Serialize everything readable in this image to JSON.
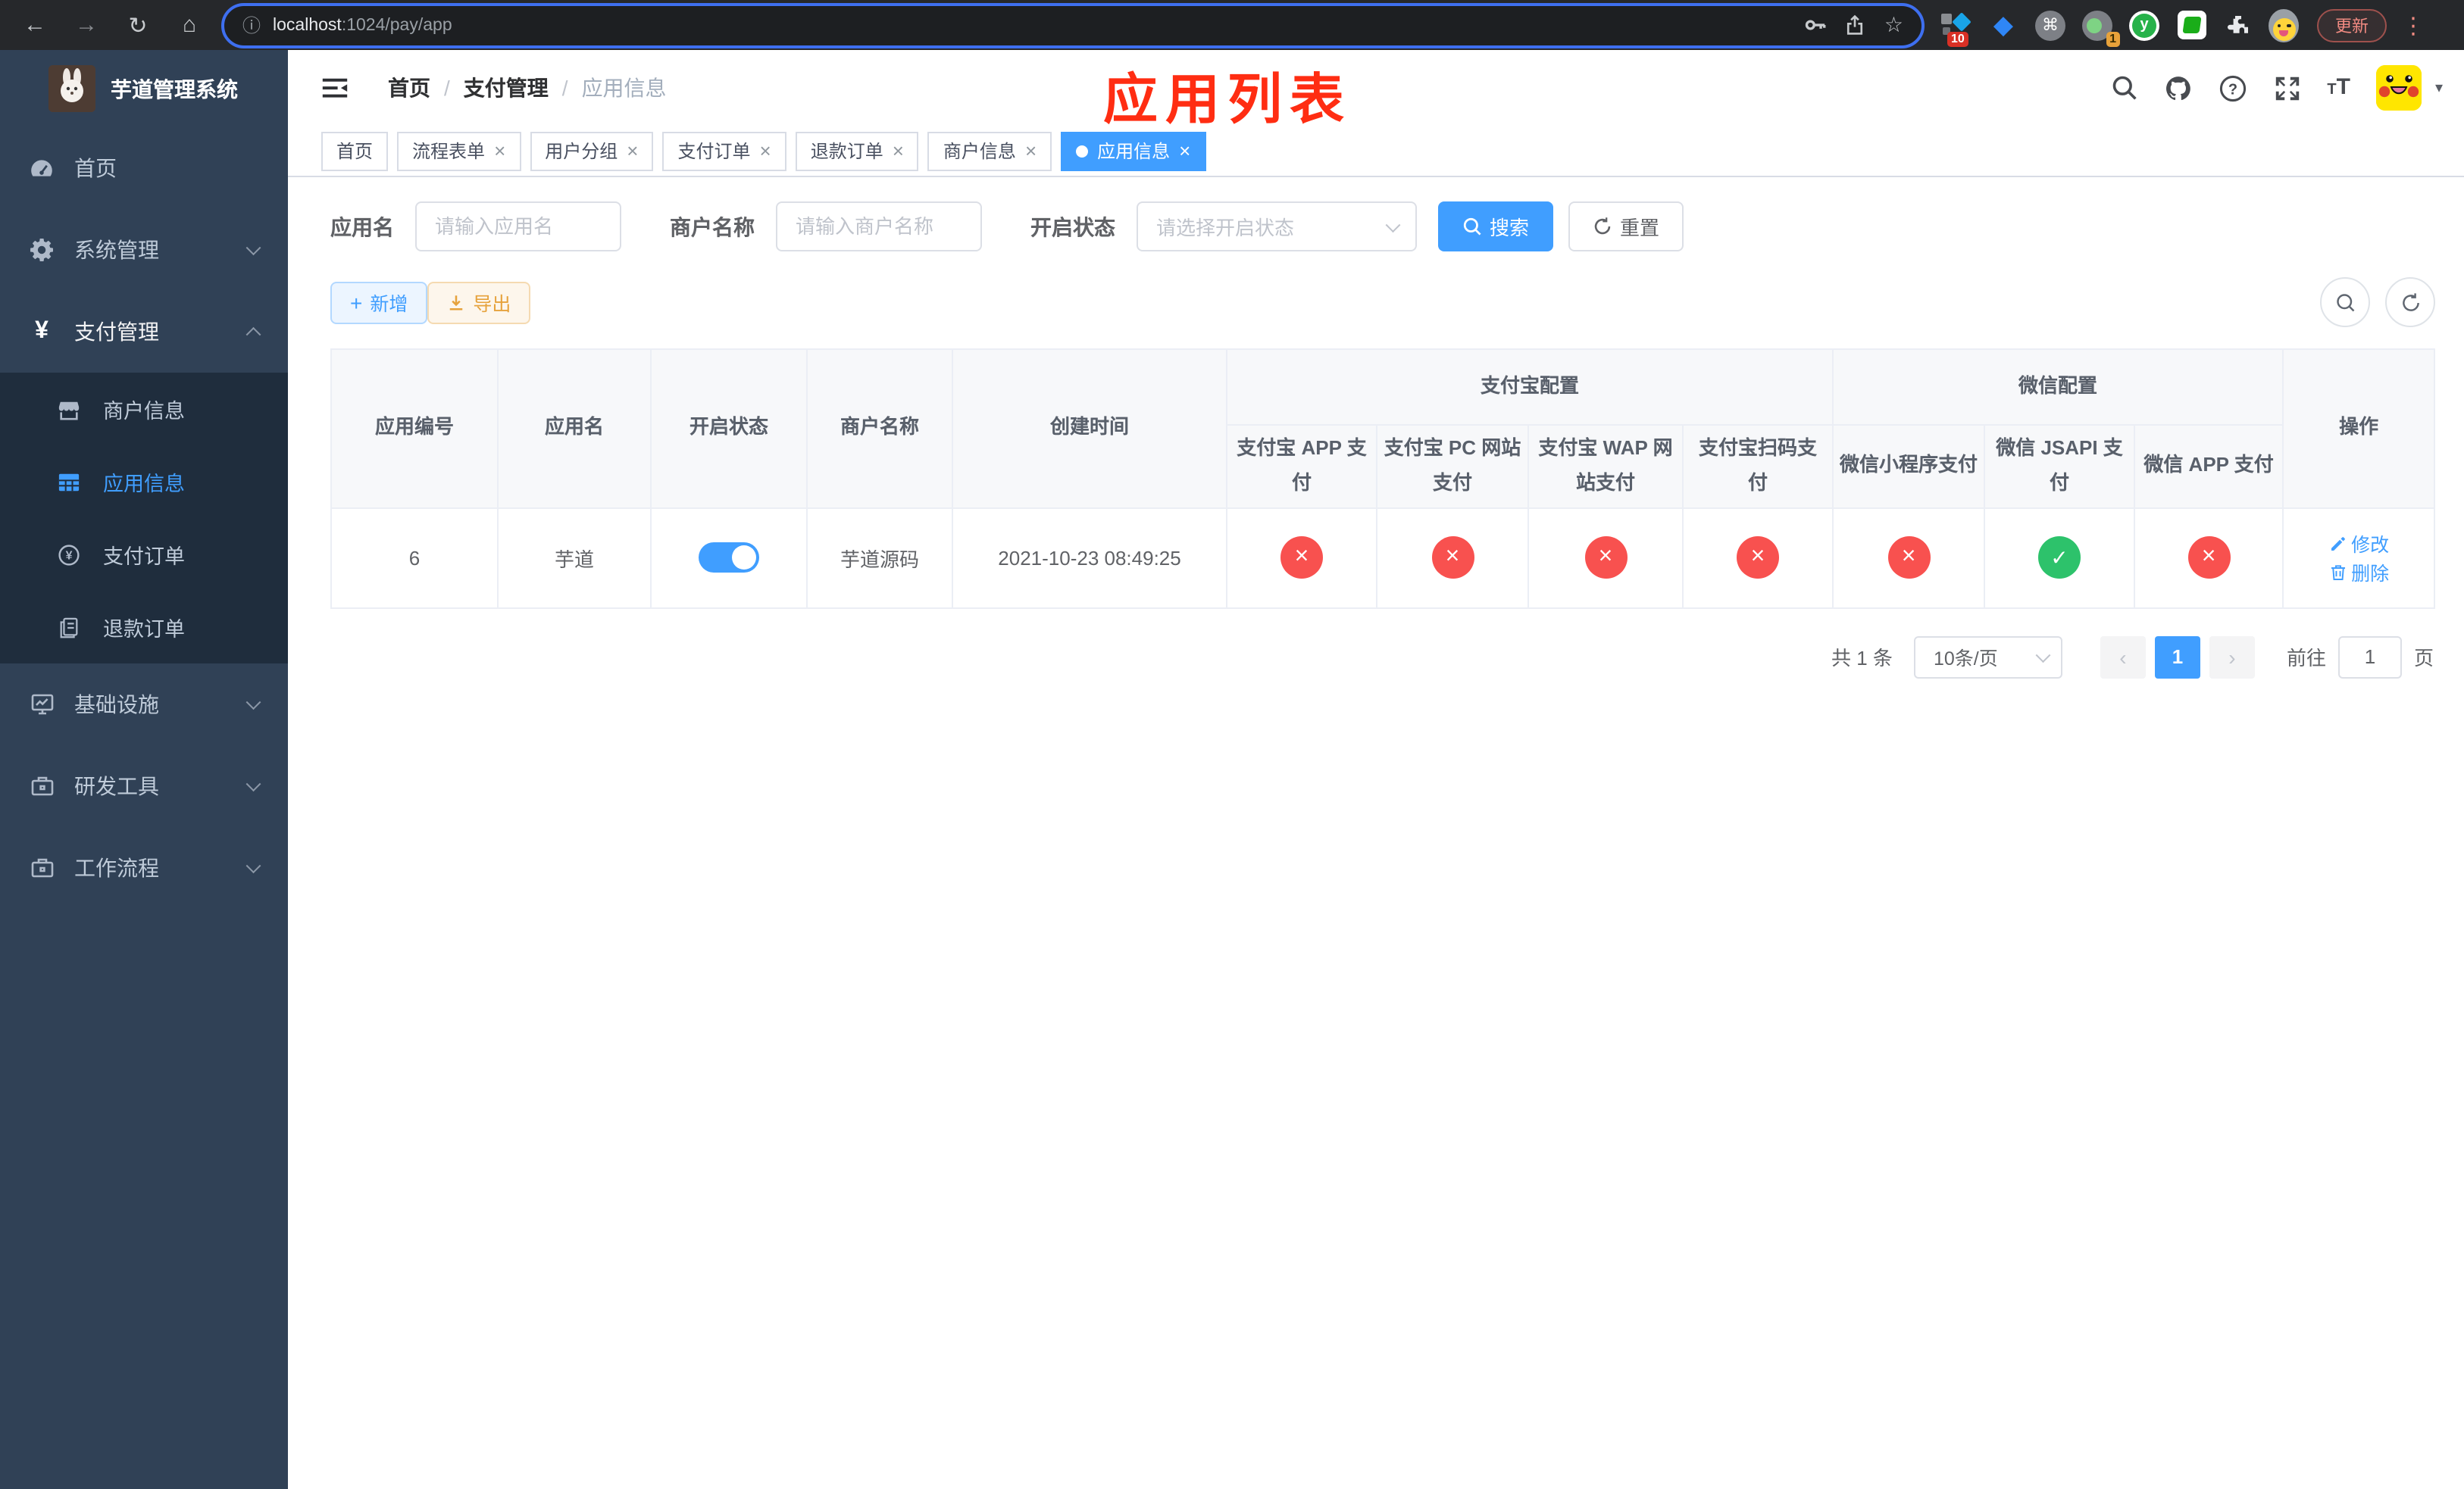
{
  "browser": {
    "url_host": "localhost",
    "url_path": ":1024/pay/app",
    "update_label": "更新",
    "ext_badge_blocks": "10",
    "ext_badge_green": "1",
    "ext_y_letter": "y"
  },
  "icons": {
    "back": "←",
    "forward": "→",
    "reload": "↻",
    "home": "⌂",
    "info": "ⓘ",
    "star": "☆",
    "menu_dots": "⋮",
    "cmd": "⌘",
    "close": "×",
    "prev": "‹",
    "next": "›",
    "caret_down": "▾",
    "status_yes": "✓",
    "status_no": "×"
  },
  "sidebar": {
    "title": "芋道管理系统",
    "menu_top": [
      {
        "label": "首页"
      },
      {
        "label": "系统管理"
      },
      {
        "label": "支付管理"
      }
    ],
    "submenu": [
      {
        "label": "商户信息"
      },
      {
        "label": "应用信息"
      },
      {
        "label": "支付订单"
      },
      {
        "label": "退款订单"
      }
    ],
    "menu_bottom": [
      {
        "label": "基础设施"
      },
      {
        "label": "研发工具"
      },
      {
        "label": "工作流程"
      }
    ]
  },
  "navbar": {
    "breadcrumb": [
      "首页",
      "支付管理",
      "应用信息"
    ],
    "separator": "/",
    "font_small": "T",
    "font_big": "T"
  },
  "annotation": {
    "title": "应用列表",
    "color": "#ff2d12"
  },
  "tabs": [
    {
      "label": "首页"
    },
    {
      "label": "流程表单"
    },
    {
      "label": "用户分组"
    },
    {
      "label": "支付订单"
    },
    {
      "label": "退款订单"
    },
    {
      "label": "商户信息"
    },
    {
      "label": "应用信息"
    }
  ],
  "filters": {
    "app_name_label": "应用名",
    "app_name_placeholder": "请输入应用名",
    "merchant_label": "商户名称",
    "merchant_placeholder": "请输入商户名称",
    "status_label": "开启状态",
    "status_placeholder": "请选择开启状态",
    "search_label": "搜索",
    "reset_label": "重置"
  },
  "toolbar": {
    "add_label": "新增",
    "export_label": "导出"
  },
  "table": {
    "col_id": "应用编号",
    "col_name": "应用名",
    "col_status": "开启状态",
    "col_merchant": "商户名称",
    "col_created": "创建时间",
    "group_alipay": "支付宝配置",
    "group_wechat": "微信配置",
    "col_op": "操作",
    "sub_cols": [
      "支付宝 APP 支付",
      "支付宝 PC 网站支付",
      "支付宝 WAP 网站支付",
      "支付宝扫码支付",
      "微信小程序支付",
      "微信 JSAPI 支付",
      "微信 APP 支付"
    ],
    "row": {
      "id": "6",
      "name": "芋道",
      "enabled": true,
      "merchant": "芋道源码",
      "created": "2021-10-23 08:49:25",
      "statuses": [
        false,
        false,
        false,
        false,
        false,
        true,
        false
      ],
      "edit_label": "修改",
      "delete_label": "删除"
    }
  },
  "pagination": {
    "total": "共 1 条",
    "page_size": "10条/页",
    "page": "1",
    "goto_label": "前往",
    "goto_value": "1",
    "unit_label": "页"
  },
  "colors": {
    "accent": "#409eff",
    "danger": "#f8514f",
    "success": "#2dc26b"
  }
}
